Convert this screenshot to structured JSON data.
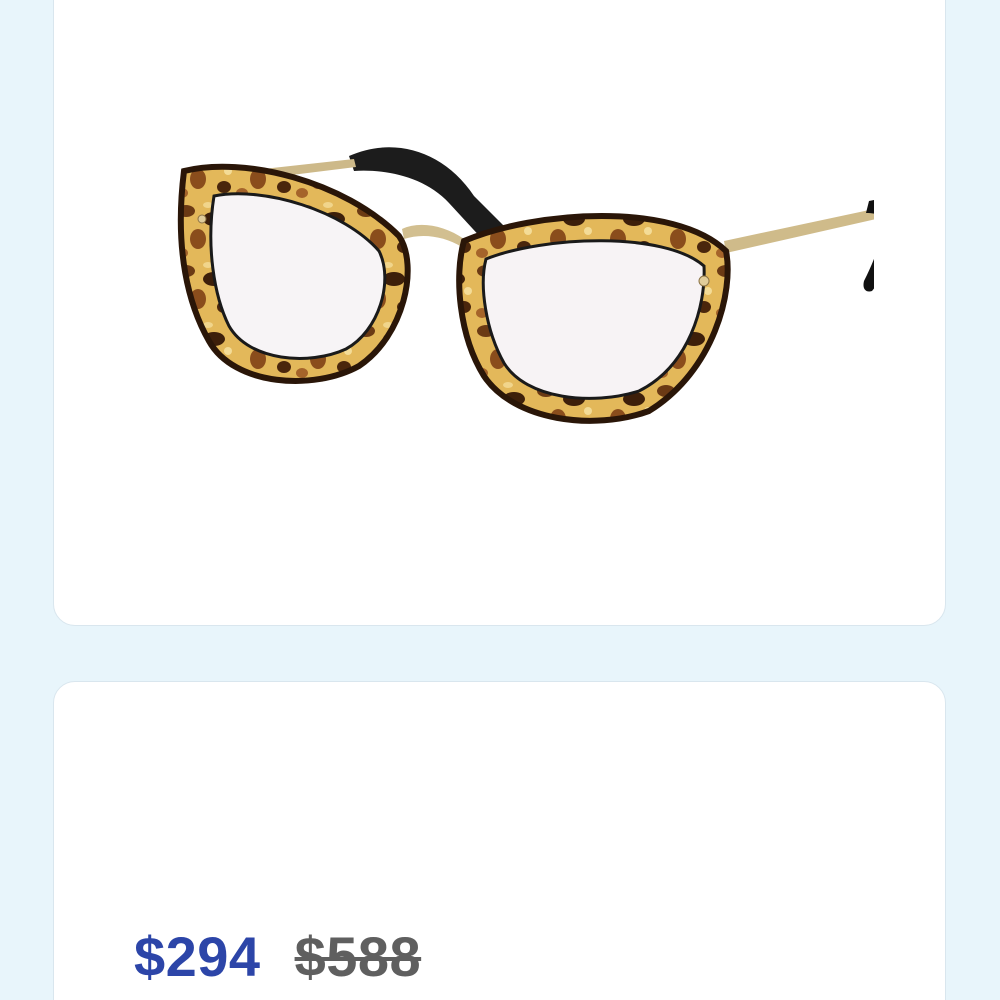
{
  "product": {
    "image_icon": "eyeglasses-image",
    "frame_style": "tortoise-cat-eye"
  },
  "pricing": {
    "current_price": "$294",
    "original_price": "$588",
    "current_color": "#2c45a8",
    "original_color": "#5f5f5f"
  }
}
